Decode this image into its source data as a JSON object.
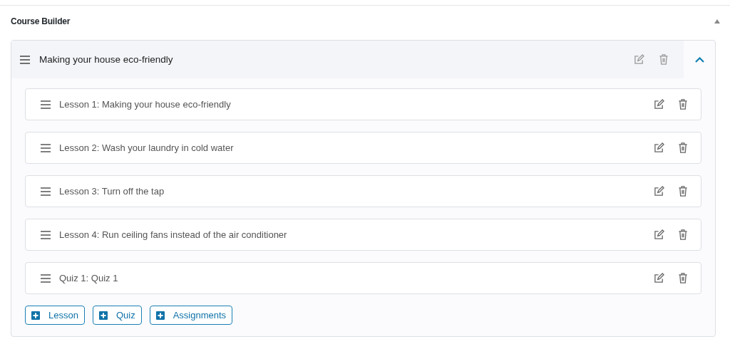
{
  "panel": {
    "title": "Course Builder",
    "expanded": true
  },
  "topic": {
    "title": "Making your house eco-friendly",
    "expanded": true,
    "items": [
      {
        "title": "Lesson 1: Making your house eco-friendly"
      },
      {
        "title": "Lesson 2: Wash your laundry in cold water"
      },
      {
        "title": "Lesson 3: Turn off the tap"
      },
      {
        "title": "Lesson 4: Run ceiling fans instead of the air conditioner"
      },
      {
        "title": "Quiz 1: Quiz 1"
      }
    ],
    "buttons": [
      "Lesson",
      "Quiz",
      "Assignments"
    ]
  }
}
